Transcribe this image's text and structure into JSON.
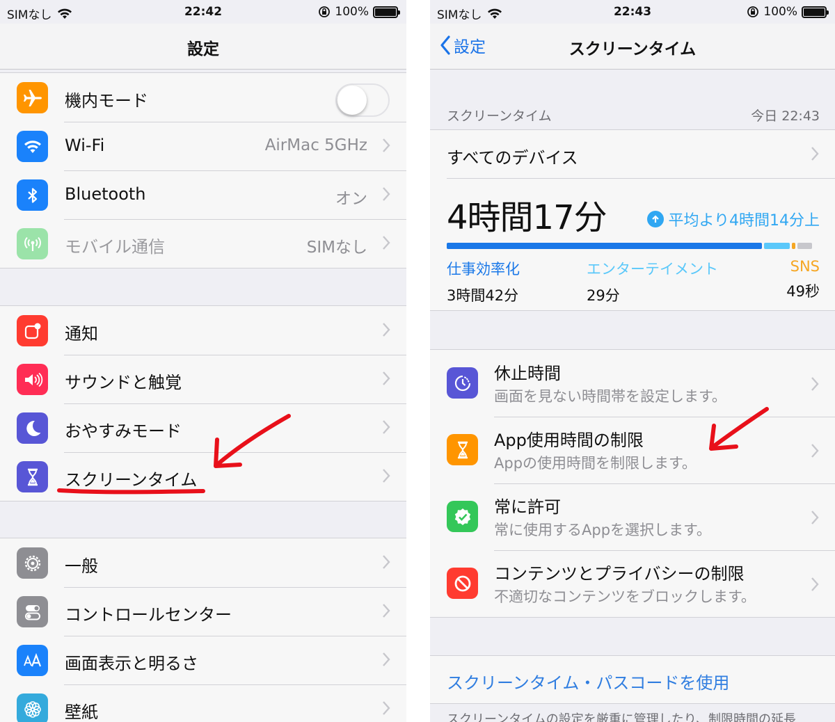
{
  "left": {
    "status": {
      "carrier": "SIMなし",
      "time": "22:42",
      "battery": "100%"
    },
    "nav_title": "設定",
    "group1": [
      {
        "label": "機内モード",
        "icon": "airplane-icon",
        "color": "#ff9500"
      },
      {
        "label": "Wi-Fi",
        "value": "AirMac 5GHz",
        "icon": "wifi-icon",
        "color": "#1a82fb"
      },
      {
        "label": "Bluetooth",
        "value": "オン",
        "icon": "bluetooth-icon",
        "color": "#1a82fb"
      },
      {
        "label": "モバイル通信",
        "value": "SIMなし",
        "icon": "antenna-icon",
        "color": "#9be3a9"
      }
    ],
    "group2": [
      {
        "label": "通知",
        "icon": "notification-icon",
        "color": "#ff3b30"
      },
      {
        "label": "サウンドと触覚",
        "icon": "speaker-icon",
        "color": "#ff2d55"
      },
      {
        "label": "おやすみモード",
        "icon": "moon-icon",
        "color": "#5856d6"
      },
      {
        "label": "スクリーンタイム",
        "icon": "hourglass-icon",
        "color": "#5856d6"
      }
    ],
    "group3": [
      {
        "label": "一般",
        "icon": "gear-icon",
        "color": "#8e8e93"
      },
      {
        "label": "コントロールセンター",
        "icon": "switches-icon",
        "color": "#8e8e93"
      },
      {
        "label": "画面表示と明るさ",
        "icon": "text-size-icon",
        "color": "#1a82fb"
      },
      {
        "label": "壁紙",
        "icon": "flower-icon",
        "color": "#34aadc"
      }
    ]
  },
  "right": {
    "status": {
      "carrier": "SIMなし",
      "time": "22:43",
      "battery": "100%"
    },
    "nav_back": "設定",
    "nav_title": "スクリーンタイム",
    "section_header": "スクリーンタイム",
    "section_time": "今日 22:43",
    "all_devices": "すべてのデバイス",
    "total": "4時間17分",
    "trend": "平均より4時間14分上",
    "usage_bar": [
      {
        "fraction": 0.86,
        "color": "#1a78e8"
      },
      {
        "fraction": 0.07,
        "color": "#5ac8fa"
      },
      {
        "fraction": 0.01,
        "color": "#f5a623"
      },
      {
        "fraction": 0.04,
        "color": "#c7c7cc"
      }
    ],
    "categories": [
      {
        "name": "仕事効率化",
        "time": "3時間42分",
        "color": "#1a78e8"
      },
      {
        "name": "エンターテイメント",
        "time": "29分",
        "color": "#5ac8fa"
      },
      {
        "name": "SNS",
        "time": "49秒",
        "color": "#f5a623"
      }
    ],
    "features": [
      {
        "title": "休止時間",
        "sub": "画面を見ない時間帯を設定します。",
        "icon": "downtime-icon",
        "color": "#5856d6"
      },
      {
        "title": "App使用時間の制限",
        "sub": "Appの使用時間を制限します。",
        "icon": "hourglass-icon",
        "color": "#ff9500"
      },
      {
        "title": "常に許可",
        "sub": "常に使用するAppを選択します。",
        "icon": "checkmark-badge-icon",
        "color": "#34c759"
      },
      {
        "title": "コンテンツとプライバシーの制限",
        "sub": "不適切なコンテンツをブロックします。",
        "icon": "no-entry-icon",
        "color": "#ff3b30"
      }
    ],
    "passcode": "スクリーンタイム・パスコードを使用",
    "footer": "スクリーンタイムの設定を厳重に管理したり、制限時間の延長"
  },
  "annotation_color": "#e8101a"
}
